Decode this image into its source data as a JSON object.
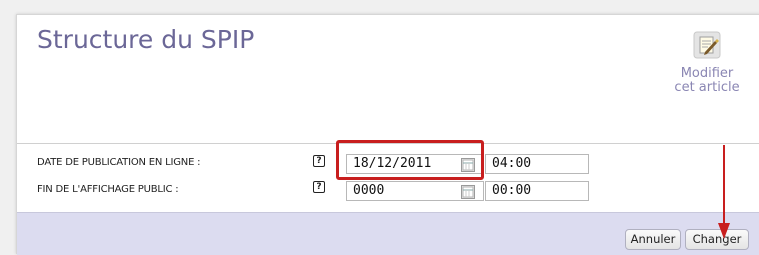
{
  "page_title": "Structure du SPIP",
  "edit_action": {
    "line1": "Modifier",
    "line2": "cet article",
    "icon": "edit-article-icon"
  },
  "rows": [
    {
      "label": "DATE DE PUBLICATION EN LIGNE :",
      "help": "?",
      "date": "18/12/2011",
      "time": "04:00"
    },
    {
      "label": "FIN DE L'AFFICHAGE PUBLIC :",
      "help": "?",
      "date": "0000",
      "time": "00:00"
    }
  ],
  "buttons": {
    "cancel": "Annuler",
    "submit": "Changer"
  },
  "colors": {
    "title": "#6b6797",
    "highlight": "#c81e1e",
    "footer": "#dcdcf0"
  }
}
